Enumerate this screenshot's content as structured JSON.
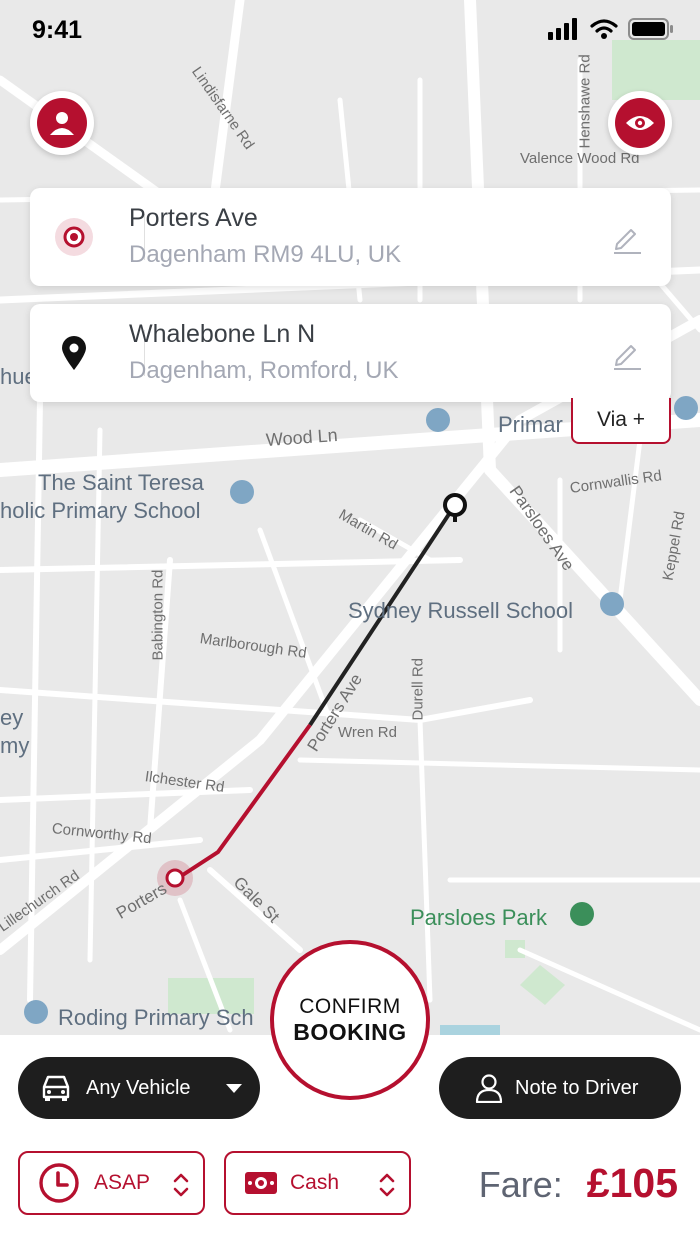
{
  "status": {
    "time": "9:41"
  },
  "pickup": {
    "title": "Porters Ave",
    "subtitle": "Dagenham RM9 4LU, UK"
  },
  "dropoff": {
    "title": "Whalebone Ln N",
    "subtitle": "Dagenham, Romford, UK"
  },
  "via_button": "Via +",
  "map_labels": {
    "lindisfarne": "Lindisfarne Rd",
    "henshawe": "Henshawe Rd",
    "valence_wood": "Valence Wood Rd",
    "wood_ln": "Wood Ln",
    "saint_teresa_1": "The Saint Teresa",
    "saint_teresa_2": "holic Primary School",
    "martin": "Martin Rd",
    "parsloes_ave": "Parsloes Ave",
    "cornwallis": "Cornwallis Rd",
    "keppel": "Keppel Rd",
    "babington": "Babington Rd",
    "sydney_russell": "Sydney Russell School",
    "marlborough": "Marlborough Rd",
    "porters_ave_road": "Porters Ave",
    "durell": "Durell Rd",
    "wren": "Wren Rd",
    "ilchester": "Ilchester Rd",
    "cornworthy": "Cornworthy Rd",
    "gale": "Gale St",
    "porters_short": "Porters",
    "lillechurch": "Lillechurch Rd",
    "parsloes_park": "Parsloes Park",
    "roding": "Roding Primary Sch",
    "primary": "Primar",
    "left_ey": "ey",
    "left_my": "my",
    "left_hue": "hue"
  },
  "confirm": {
    "line1": "CONFIRM",
    "line2": "BOOKING"
  },
  "vehicle": {
    "label": "Any Vehicle"
  },
  "note": {
    "label": "Note to Driver"
  },
  "time_select": {
    "label": "ASAP"
  },
  "payment_select": {
    "label": "Cash"
  },
  "fare": {
    "label": "Fare:",
    "amount": "£105"
  },
  "colors": {
    "accent": "#b5102f",
    "dark": "#1e1e1e"
  },
  "icons": [
    "profile-icon",
    "eye-icon",
    "target-pin-icon",
    "location-pin-icon",
    "edit-icon",
    "car-icon",
    "chevron-down-icon",
    "person-icon",
    "clock-icon",
    "cash-icon",
    "updown-chevron-icon"
  ]
}
